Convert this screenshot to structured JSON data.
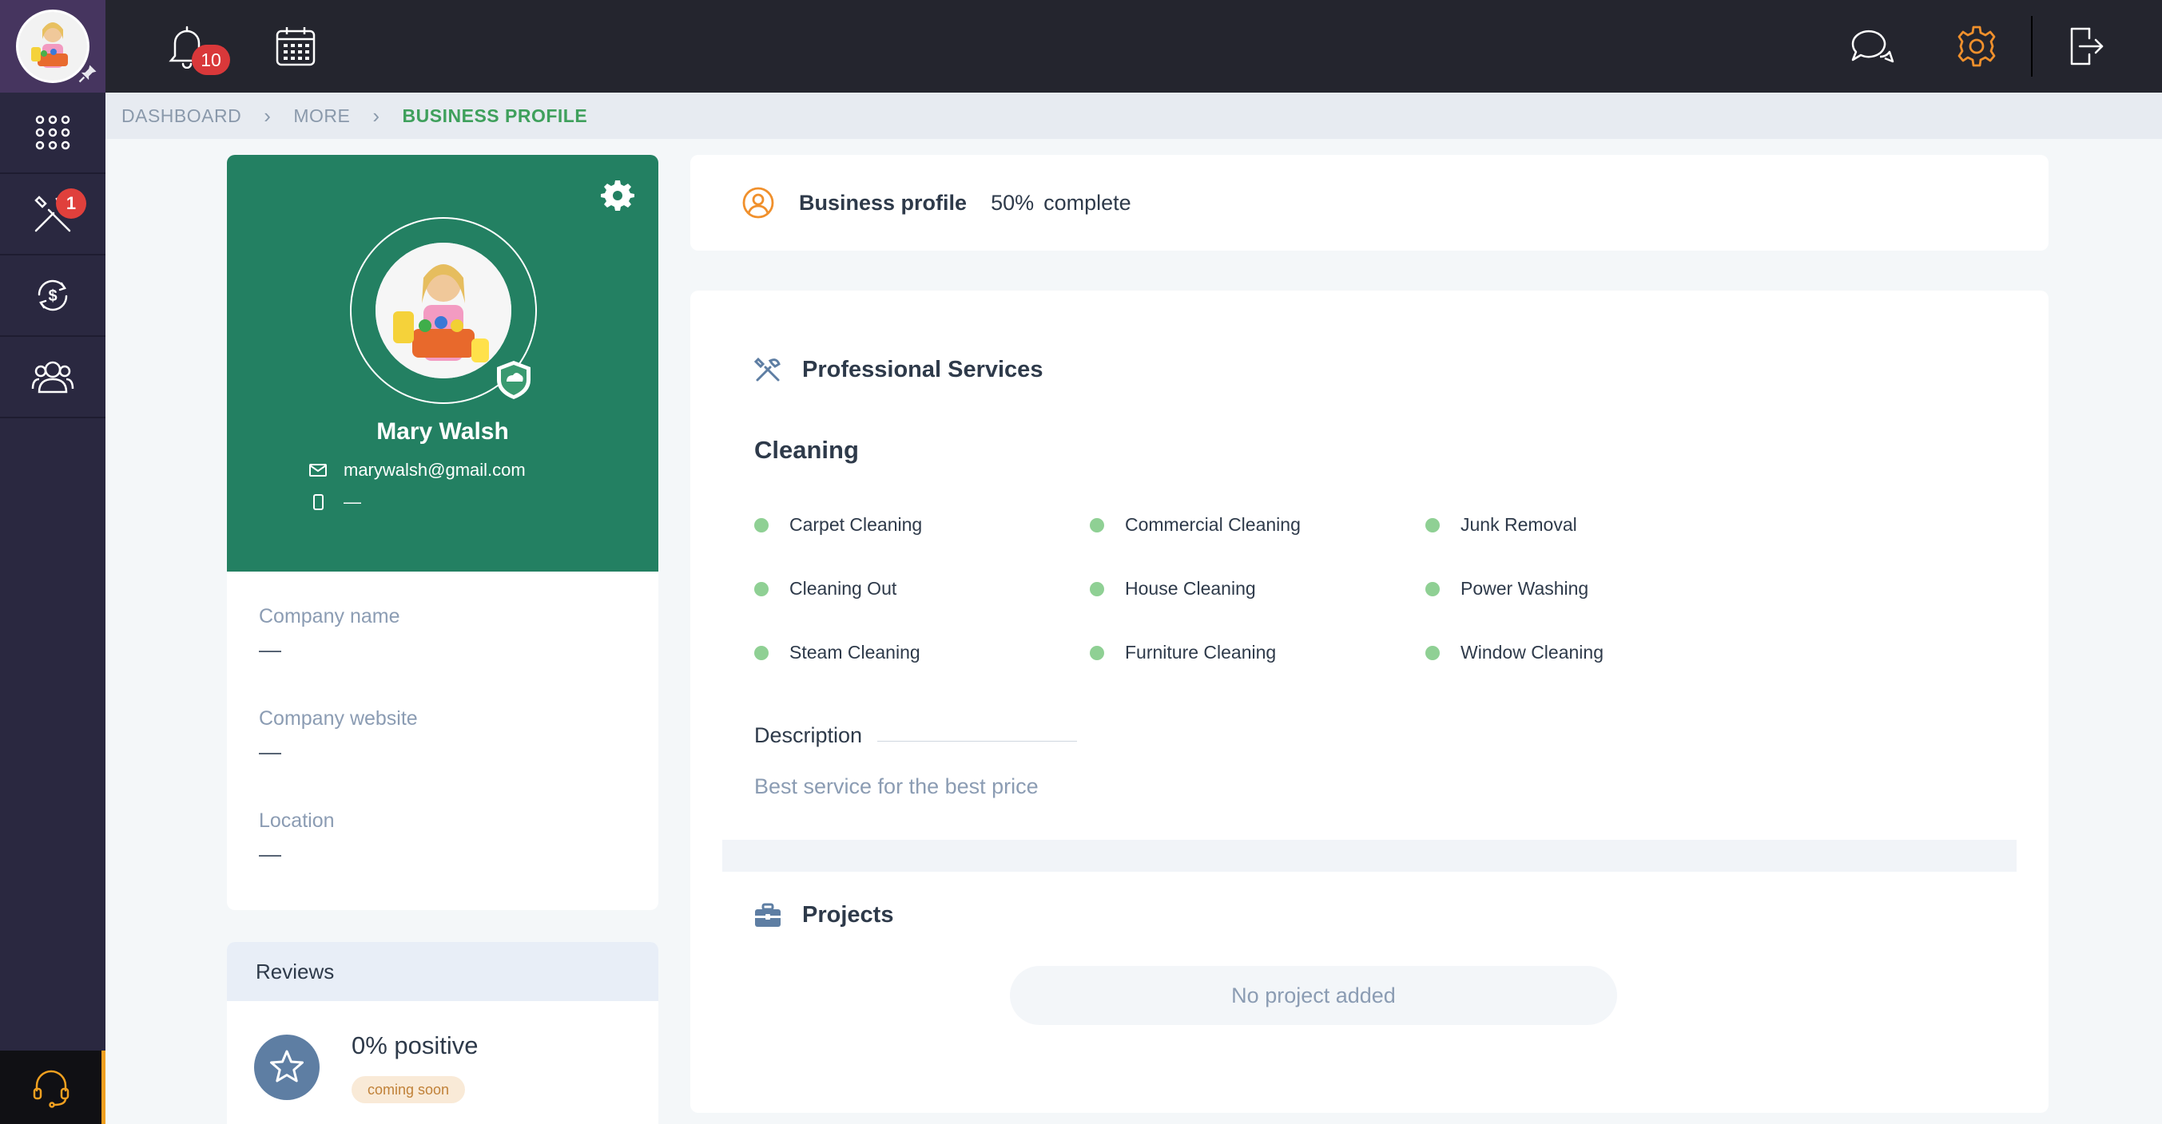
{
  "sidebar": {
    "items": [
      {
        "name": "apps",
        "icon": "grid-icon"
      },
      {
        "name": "services",
        "icon": "tools-icon",
        "badge": "1"
      },
      {
        "name": "payments",
        "icon": "dollar-cycle-icon"
      },
      {
        "name": "team",
        "icon": "users-icon"
      }
    ],
    "support_icon": "headset-icon"
  },
  "topbar": {
    "notification_count": "10",
    "icons": [
      "bell-icon",
      "calendar-icon",
      "chat-icon",
      "gear-icon",
      "logout-icon"
    ]
  },
  "breadcrumb": [
    "DASHBOARD",
    "MORE",
    "BUSINESS PROFILE"
  ],
  "profile": {
    "name": "Mary Walsh",
    "email": "marywalsh@gmail.com",
    "phone": "—"
  },
  "info": {
    "company_name_label": "Company name",
    "company_name_value": "—",
    "company_website_label": "Company website",
    "company_website_value": "—",
    "location_label": "Location",
    "location_value": "—"
  },
  "reviews": {
    "title": "Reviews",
    "positive": "0% positive",
    "badge": "coming soon"
  },
  "completion": {
    "title": "Business profile",
    "percent": "50%",
    "suffix": "complete",
    "value": 0.5
  },
  "services": {
    "title": "Professional Services",
    "category": "Cleaning",
    "items": [
      "Carpet Cleaning",
      "Commercial Cleaning",
      "Junk Removal",
      "Cleaning Out",
      "House Cleaning",
      "Power Washing",
      "Steam Cleaning",
      "Furniture Cleaning",
      "Window Cleaning"
    ],
    "description_label": "Description",
    "description_text": "Best service for the best price"
  },
  "projects": {
    "title": "Projects",
    "empty": "No project added"
  },
  "colors": {
    "sidebar": "#2a2840",
    "topbar": "#24252e",
    "profile_green": "#238062",
    "accent_orange": "#f0902c",
    "dot_green": "#8fd094"
  }
}
